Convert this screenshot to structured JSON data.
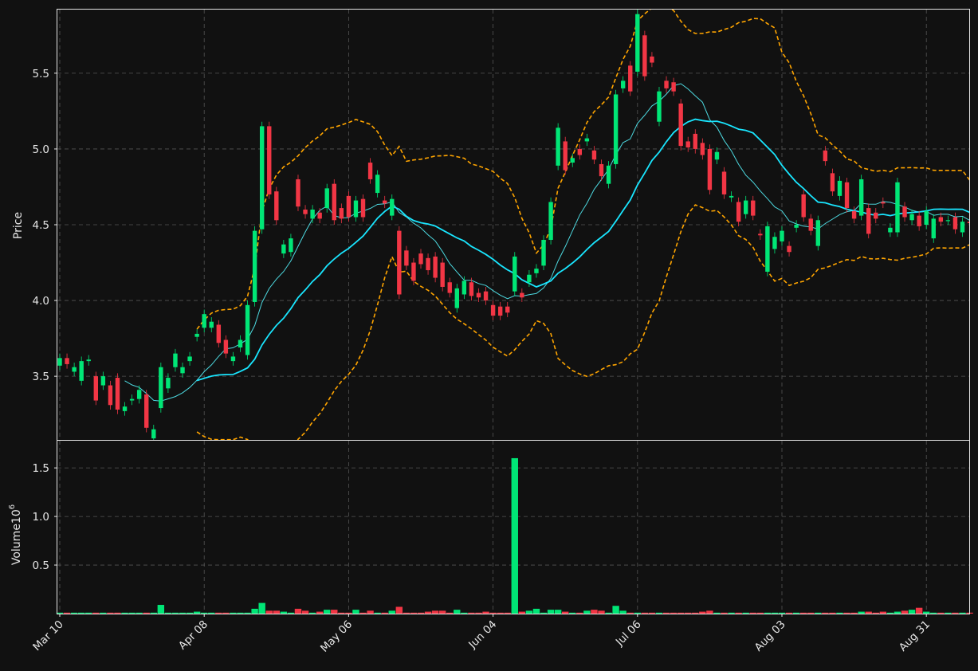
{
  "chart_data": {
    "type": "candlestick",
    "title": "",
    "ylabel": "Price",
    "volume_label": "Volume",
    "volume_exponent": "10",
    "volume_exponent_power": "6",
    "x_tick_labels": [
      "Mar 10",
      "Apr 08",
      "May 06",
      "Jun 04",
      "Jul 06",
      "Aug 03",
      "Aug 31"
    ],
    "x_tick_indices": [
      0,
      20,
      40,
      60,
      80,
      100,
      120
    ],
    "price_ticks": [
      3.5,
      4.0,
      4.5,
      5.0,
      5.5
    ],
    "price_ylim": [
      3.08,
      5.92
    ],
    "volume_ticks": [
      0.5,
      1.0,
      1.5
    ],
    "volume_ylim": [
      0,
      1.78
    ],
    "grid": true,
    "colors": {
      "background": "#111111",
      "up": "#00e676",
      "down": "#f23645",
      "ma_fast": "#4dd9e0",
      "ma_slow": "#19e6ff",
      "bands": "#ffa500",
      "axis": "#e6e6e6",
      "grid": "#555555"
    },
    "overlays": [
      "moving-average-fast",
      "moving-average-slow",
      "bollinger-upper",
      "bollinger-lower"
    ],
    "candles": [
      [
        3.57,
        3.62
      ],
      [
        3.62,
        3.58
      ],
      [
        3.53,
        3.56
      ],
      [
        3.47,
        3.6
      ],
      [
        3.6,
        3.61
      ],
      [
        3.5,
        3.34
      ],
      [
        3.44,
        3.5
      ],
      [
        3.44,
        3.31
      ],
      [
        3.49,
        3.28
      ],
      [
        3.27,
        3.3
      ],
      [
        3.34,
        3.35
      ],
      [
        3.35,
        3.41
      ],
      [
        3.38,
        3.16
      ],
      [
        3.09,
        3.15
      ],
      [
        3.29,
        3.56
      ],
      [
        3.42,
        3.49
      ],
      [
        3.56,
        3.65
      ],
      [
        3.52,
        3.56
      ],
      [
        3.6,
        3.63
      ],
      [
        3.76,
        3.78
      ],
      [
        3.82,
        3.91
      ],
      [
        3.82,
        3.86
      ],
      [
        3.84,
        3.72
      ],
      [
        3.74,
        3.65
      ],
      [
        3.6,
        3.63
      ],
      [
        3.69,
        3.74
      ],
      [
        3.64,
        3.97
      ],
      [
        3.99,
        4.46
      ],
      [
        4.47,
        5.15
      ],
      [
        5.15,
        4.7
      ],
      [
        4.72,
        4.53
      ],
      [
        4.31,
        4.37
      ],
      [
        4.32,
        4.41
      ],
      [
        4.8,
        4.62
      ],
      [
        4.6,
        4.57
      ],
      [
        4.54,
        4.6
      ],
      [
        4.58,
        4.54
      ],
      [
        4.61,
        4.74
      ],
      [
        4.77,
        4.53
      ],
      [
        4.61,
        4.54
      ],
      [
        4.69,
        4.55
      ],
      [
        4.55,
        4.66
      ],
      [
        4.67,
        4.55
      ],
      [
        4.91,
        4.8
      ],
      [
        4.71,
        4.83
      ],
      [
        4.66,
        4.64
      ],
      [
        4.56,
        4.67
      ],
      [
        4.46,
        4.04
      ],
      [
        4.33,
        4.23
      ],
      [
        4.25,
        4.13
      ],
      [
        4.31,
        4.24
      ],
      [
        4.28,
        4.2
      ],
      [
        4.29,
        4.15
      ],
      [
        4.25,
        4.09
      ],
      [
        4.12,
        4.05
      ],
      [
        3.95,
        4.08
      ],
      [
        4.04,
        4.13
      ],
      [
        4.12,
        4.03
      ],
      [
        4.05,
        4.02
      ],
      [
        4.06,
        4.0
      ],
      [
        3.97,
        3.9
      ],
      [
        3.96,
        3.9
      ],
      [
        3.96,
        3.92
      ],
      [
        4.06,
        4.29
      ],
      [
        4.05,
        4.02
      ],
      [
        4.12,
        4.17
      ],
      [
        4.18,
        4.21
      ],
      [
        4.23,
        4.4
      ],
      [
        4.4,
        4.65
      ],
      [
        4.89,
        5.14
      ],
      [
        5.05,
        4.86
      ],
      [
        4.91,
        4.94
      ],
      [
        5.0,
        4.96
      ],
      [
        5.05,
        5.07
      ],
      [
        4.99,
        4.93
      ],
      [
        4.9,
        4.82
      ],
      [
        4.77,
        4.89
      ],
      [
        4.9,
        5.36
      ],
      [
        5.4,
        5.45
      ],
      [
        5.55,
        5.38
      ],
      [
        5.51,
        5.89
      ],
      [
        5.75,
        5.48
      ],
      [
        5.61,
        5.57
      ],
      [
        5.18,
        5.38
      ],
      [
        5.45,
        5.4
      ],
      [
        5.44,
        5.38
      ],
      [
        5.3,
        5.02
      ],
      [
        5.05,
        5.01
      ],
      [
        5.1,
        5.0
      ],
      [
        5.04,
        4.96
      ],
      [
        5.0,
        4.73
      ],
      [
        4.93,
        4.98
      ],
      [
        4.85,
        4.7
      ],
      [
        4.68,
        4.69
      ],
      [
        4.65,
        4.52
      ],
      [
        4.57,
        4.66
      ],
      [
        4.66,
        4.56
      ],
      [
        4.44,
        4.43
      ],
      [
        4.19,
        4.49
      ],
      [
        4.34,
        4.42
      ],
      [
        4.39,
        4.46
      ],
      [
        4.36,
        4.32
      ],
      [
        4.48,
        4.5
      ],
      [
        4.7,
        4.55
      ],
      [
        4.54,
        4.46
      ],
      [
        4.36,
        4.53
      ],
      [
        4.99,
        4.92
      ],
      [
        4.84,
        4.72
      ],
      [
        4.69,
        4.79
      ],
      [
        4.78,
        4.61
      ],
      [
        4.59,
        4.54
      ],
      [
        4.56,
        4.8
      ],
      [
        4.61,
        4.44
      ],
      [
        4.58,
        4.54
      ],
      [
        4.65,
        4.64
      ],
      [
        4.45,
        4.48
      ],
      [
        4.45,
        4.78
      ],
      [
        4.62,
        4.55
      ],
      [
        4.53,
        4.57
      ],
      [
        4.56,
        4.49
      ],
      [
        4.5,
        4.59
      ],
      [
        4.41,
        4.54
      ],
      [
        4.55,
        4.52
      ],
      [
        4.53,
        4.53
      ],
      [
        4.55,
        4.47
      ],
      [
        4.45,
        4.52
      ],
      [
        4.52,
        4.51
      ]
    ],
    "volume": [
      0.01,
      0.01,
      0.0,
      0.01,
      0.01,
      0.01,
      0.0,
      0.01,
      0.01,
      0.0,
      0.0,
      0.0,
      0.01,
      0.01,
      0.09,
      0.0,
      0.0,
      0.0,
      0.0,
      0.02,
      0.01,
      0.01,
      0.01,
      0.0,
      0.0,
      0.0,
      0.0,
      0.05,
      0.11,
      0.03,
      0.03,
      0.02,
      0.01,
      0.05,
      0.03,
      0.01,
      0.02,
      0.04,
      0.04,
      0.01,
      0.0,
      0.04,
      0.0,
      0.03,
      0.0,
      0.01,
      0.03,
      0.07,
      0.01,
      0.0,
      0.01,
      0.02,
      0.03,
      0.03,
      0.0,
      0.04,
      0.0,
      0.01,
      0.01,
      0.02,
      0.01,
      0.0,
      0.0,
      1.6,
      0.02,
      0.03,
      0.05,
      0.01,
      0.04,
      0.04,
      0.02,
      0.0,
      0.0,
      0.03,
      0.04,
      0.03,
      0.01,
      0.08,
      0.03,
      0.01,
      0.01,
      0.01,
      0.01,
      0.0,
      0.0,
      0.0,
      0.0,
      0.0,
      0.0,
      0.02,
      0.03,
      0.0,
      0.01,
      0.01,
      0.0,
      0.0,
      0.01,
      0.0,
      0.0,
      0.0,
      0.0,
      0.0,
      0.0,
      0.0,
      0.0,
      0.0,
      0.0,
      0.0,
      0.0,
      0.0,
      0.0,
      0.02,
      0.02,
      0.01,
      0.02,
      0.0,
      0.02,
      0.03,
      0.04,
      0.06,
      0.02,
      0.01,
      0.0,
      0.0,
      0.01,
      0.01,
      0.01
    ]
  }
}
